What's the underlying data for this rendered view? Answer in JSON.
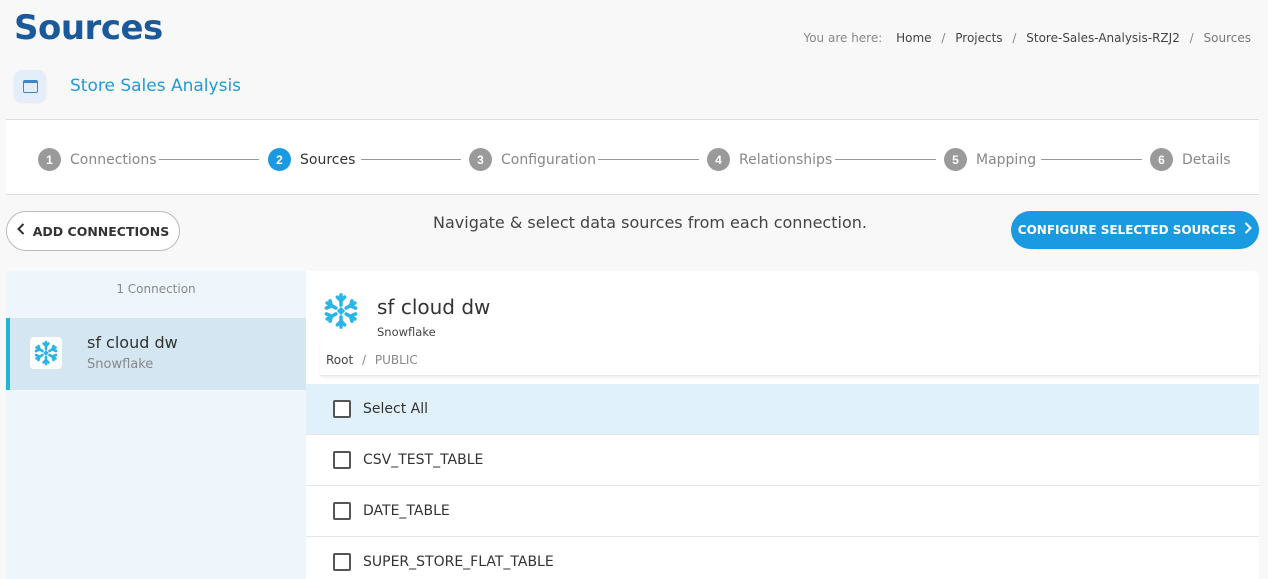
{
  "page": {
    "title": "Sources"
  },
  "breadcrumb": {
    "prefix": "You are here:",
    "items": [
      "Home",
      "Projects",
      "Store-Sales-Analysis-RZJ2",
      "Sources"
    ]
  },
  "project": {
    "name": "Store Sales Analysis",
    "icon": "window-icon"
  },
  "stepper": {
    "steps": [
      {
        "number": "1",
        "label": "Connections",
        "active": false
      },
      {
        "number": "2",
        "label": "Sources",
        "active": true
      },
      {
        "number": "3",
        "label": "Configuration",
        "active": false
      },
      {
        "number": "4",
        "label": "Relationships",
        "active": false
      },
      {
        "number": "5",
        "label": "Mapping",
        "active": false
      },
      {
        "number": "6",
        "label": "Details",
        "active": false
      }
    ]
  },
  "actions": {
    "add_connections_label": "ADD CONNECTIONS",
    "instruction": "Navigate & select data sources from each connection.",
    "configure_label": "CONFIGURE SELECTED SOURCES"
  },
  "connections_panel": {
    "count_label": "1 Connection",
    "items": [
      {
        "name": "sf cloud dw",
        "type": "Snowflake",
        "icon": "snowflake-icon",
        "selected": true
      }
    ]
  },
  "sources_panel": {
    "connection_name": "sf cloud dw",
    "connection_type": "Snowflake",
    "path": {
      "root": "Root",
      "current": "PUBLIC"
    },
    "select_all_label": "Select All",
    "tables": [
      {
        "name": "CSV_TEST_TABLE",
        "checked": false
      },
      {
        "name": "DATE_TABLE",
        "checked": false
      },
      {
        "name": "SUPER_STORE_FLAT_TABLE",
        "checked": false
      }
    ]
  },
  "colors": {
    "title": "#1b5a9a",
    "accent": "#1a9ae0",
    "project_name": "#1e9bd7",
    "snowflake": "#29b5e8",
    "selected_row": "#e1f1fb"
  }
}
